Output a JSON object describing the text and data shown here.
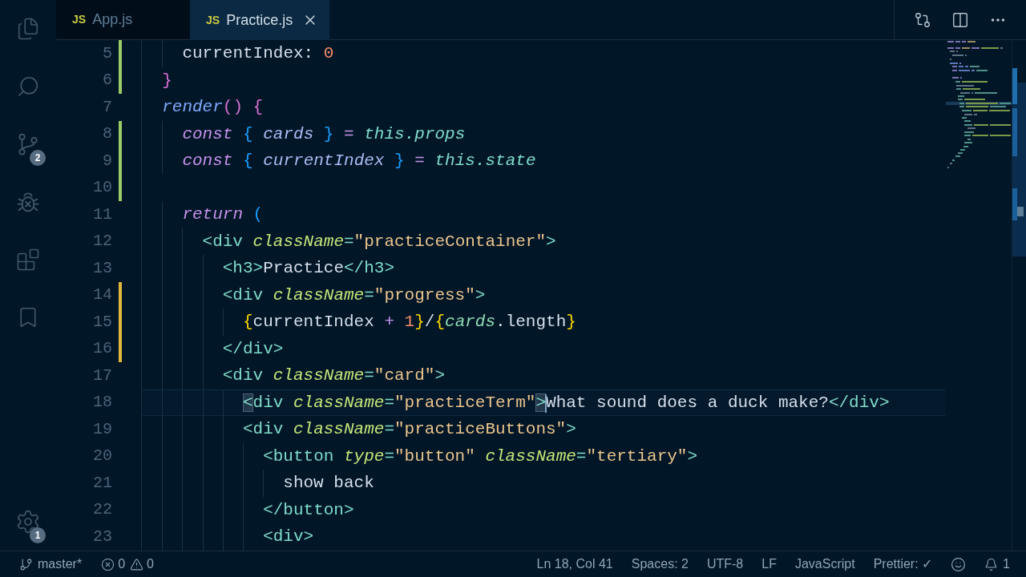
{
  "activity_bar": {
    "items": [
      {
        "kind": "files",
        "selected": false
      },
      {
        "kind": "search",
        "selected": false
      },
      {
        "kind": "source-control",
        "selected": false,
        "badge": "2"
      },
      {
        "kind": "debug",
        "selected": false
      },
      {
        "kind": "extensions",
        "selected": false
      },
      {
        "kind": "bookmarks",
        "selected": false
      }
    ],
    "bottom_items": [
      {
        "kind": "settings",
        "selected": false,
        "badge": "1"
      }
    ]
  },
  "tabs": [
    {
      "icon_text": "JS",
      "label": "App.js",
      "selected": false
    },
    {
      "icon_text": "JS",
      "label": "Practice.js",
      "selected": true
    }
  ],
  "editor": {
    "lines": [
      {
        "number": "5",
        "added": true,
        "modified": false,
        "current": false,
        "tokens": [
          {
            "kind": "plain",
            "text": "    currentIndex: "
          },
          {
            "kind": "number",
            "text": "0"
          }
        ]
      },
      {
        "number": "6",
        "added": true,
        "modified": false,
        "current": false,
        "tokens": [
          {
            "kind": "bracket2",
            "text": "  }"
          }
        ]
      },
      {
        "number": "7",
        "added": false,
        "modified": false,
        "current": false,
        "tokens": [
          {
            "kind": "function",
            "text": "  render"
          },
          {
            "kind": "bracket2",
            "text": "() {"
          }
        ]
      },
      {
        "number": "8",
        "added": true,
        "modified": false,
        "current": false,
        "tokens": [
          {
            "kind": "keyword",
            "text": "    const "
          },
          {
            "kind": "bracket3",
            "text": "{ "
          },
          {
            "kind": "binding",
            "text": "cards "
          },
          {
            "kind": "bracket3",
            "text": "}"
          },
          {
            "kind": "operator",
            "text": " = "
          },
          {
            "kind": "this",
            "text": "this.props"
          }
        ]
      },
      {
        "number": "9",
        "added": true,
        "modified": false,
        "current": false,
        "tokens": [
          {
            "kind": "keyword",
            "text": "    const "
          },
          {
            "kind": "bracket3",
            "text": "{ "
          },
          {
            "kind": "binding",
            "text": "currentIndex "
          },
          {
            "kind": "bracket3",
            "text": "}"
          },
          {
            "kind": "operator",
            "text": " = "
          },
          {
            "kind": "this",
            "text": "this.state"
          }
        ]
      },
      {
        "number": "10",
        "added": true,
        "modified": false,
        "current": false
      },
      {
        "number": "11",
        "added": false,
        "modified": false,
        "current": false,
        "tokens": [
          {
            "kind": "keyword",
            "text": "    return "
          },
          {
            "kind": "bracket3",
            "text": "("
          }
        ]
      },
      {
        "number": "12",
        "added": false,
        "modified": false,
        "current": false,
        "tokens": [
          {
            "kind": "tag",
            "text": "      <div "
          },
          {
            "kind": "attr",
            "text": "className"
          },
          {
            "kind": "tag",
            "text": "="
          },
          {
            "kind": "string",
            "text": "\"practiceContainer\""
          },
          {
            "kind": "tag",
            "text": ">"
          }
        ]
      },
      {
        "number": "13",
        "added": false,
        "modified": false,
        "current": false,
        "tokens": [
          {
            "kind": "tag",
            "text": "        <h3>"
          },
          {
            "kind": "text",
            "text": "Practice"
          },
          {
            "kind": "tag",
            "text": "</h3>"
          }
        ]
      },
      {
        "number": "14",
        "added": false,
        "modified": true,
        "current": false,
        "tokens": [
          {
            "kind": "tag",
            "text": "        <div "
          },
          {
            "kind": "attr",
            "text": "className"
          },
          {
            "kind": "tag",
            "text": "="
          },
          {
            "kind": "string",
            "text": "\"progress\""
          },
          {
            "kind": "tag",
            "text": ">"
          }
        ]
      },
      {
        "number": "15",
        "added": false,
        "modified": true,
        "current": false,
        "tokens": [
          {
            "kind": "bracket1",
            "text": "          {"
          },
          {
            "kind": "plain",
            "text": "currentIndex "
          },
          {
            "kind": "operator",
            "text": "+ "
          },
          {
            "kind": "number",
            "text": "1"
          },
          {
            "kind": "bracket1",
            "text": "}"
          },
          {
            "kind": "text",
            "text": "/"
          },
          {
            "kind": "bracket1",
            "text": "{"
          },
          {
            "kind": "object",
            "text": "cards"
          },
          {
            "kind": "plain",
            "text": ".length"
          },
          {
            "kind": "bracket1",
            "text": "}"
          }
        ]
      },
      {
        "number": "16",
        "added": false,
        "modified": true,
        "current": false,
        "tokens": [
          {
            "kind": "tag",
            "text": "        </div>"
          }
        ]
      },
      {
        "number": "17",
        "added": false,
        "modified": false,
        "current": false,
        "tokens": [
          {
            "kind": "tag",
            "text": "        <div "
          },
          {
            "kind": "attr",
            "text": "className"
          },
          {
            "kind": "tag",
            "text": "="
          },
          {
            "kind": "string",
            "text": "\"card\""
          },
          {
            "kind": "tag",
            "text": ">"
          }
        ]
      },
      {
        "number": "18",
        "added": false,
        "modified": false,
        "current": true,
        "tokens": [
          {
            "kind": "tag-matched",
            "text": "          <"
          },
          {
            "kind": "tag",
            "text": "div "
          },
          {
            "kind": "attr",
            "text": "className"
          },
          {
            "kind": "tag",
            "text": "="
          },
          {
            "kind": "string",
            "text": "\"practiceTerm\""
          },
          {
            "kind": "tag-matched",
            "text": ">"
          },
          {
            "kind": "cursor"
          },
          {
            "kind": "text",
            "text": "What sound does a duck make?"
          },
          {
            "kind": "tag",
            "text": "</div>"
          }
        ]
      },
      {
        "number": "19",
        "added": false,
        "modified": false,
        "current": false,
        "tokens": [
          {
            "kind": "tag",
            "text": "          <div "
          },
          {
            "kind": "attr",
            "text": "className"
          },
          {
            "kind": "tag",
            "text": "="
          },
          {
            "kind": "string",
            "text": "\"practiceButtons\""
          },
          {
            "kind": "tag",
            "text": ">"
          }
        ]
      },
      {
        "number": "20",
        "added": false,
        "modified": false,
        "current": false,
        "tokens": [
          {
            "kind": "tag",
            "text": "            <button "
          },
          {
            "kind": "attr",
            "text": "type"
          },
          {
            "kind": "tag",
            "text": "="
          },
          {
            "kind": "string",
            "text": "\"button\""
          },
          {
            "kind": "attr",
            "text": " className"
          },
          {
            "kind": "tag",
            "text": "="
          },
          {
            "kind": "string",
            "text": "\"tertiary\""
          },
          {
            "kind": "tag",
            "text": ">"
          }
        ]
      },
      {
        "number": "21",
        "added": false,
        "modified": false,
        "current": false,
        "tokens": [
          {
            "kind": "text",
            "text": "              show back"
          }
        ]
      },
      {
        "number": "22",
        "added": false,
        "modified": false,
        "current": false,
        "tokens": [
          {
            "kind": "tag",
            "text": "            </button>"
          }
        ]
      },
      {
        "number": "23",
        "added": false,
        "modified": false,
        "current": false,
        "tokens": [
          {
            "kind": "tag",
            "text": "            <div>"
          }
        ]
      }
    ]
  },
  "status_bar": {
    "left": [
      {
        "kind": "branch",
        "text": "master*"
      },
      {
        "kind": "problems",
        "errors": "0",
        "warnings": "0"
      }
    ],
    "right": [
      {
        "kind": "text",
        "text": "Ln 18, Col 41"
      },
      {
        "kind": "text",
        "text": "Spaces: 2"
      },
      {
        "kind": "text",
        "text": "UTF-8"
      },
      {
        "kind": "text",
        "text": "LF"
      },
      {
        "kind": "text",
        "text": "JavaScript"
      },
      {
        "kind": "text",
        "text": "Prettier: ✓"
      },
      {
        "kind": "feedback"
      },
      {
        "kind": "notifications",
        "text": "1"
      }
    ]
  }
}
